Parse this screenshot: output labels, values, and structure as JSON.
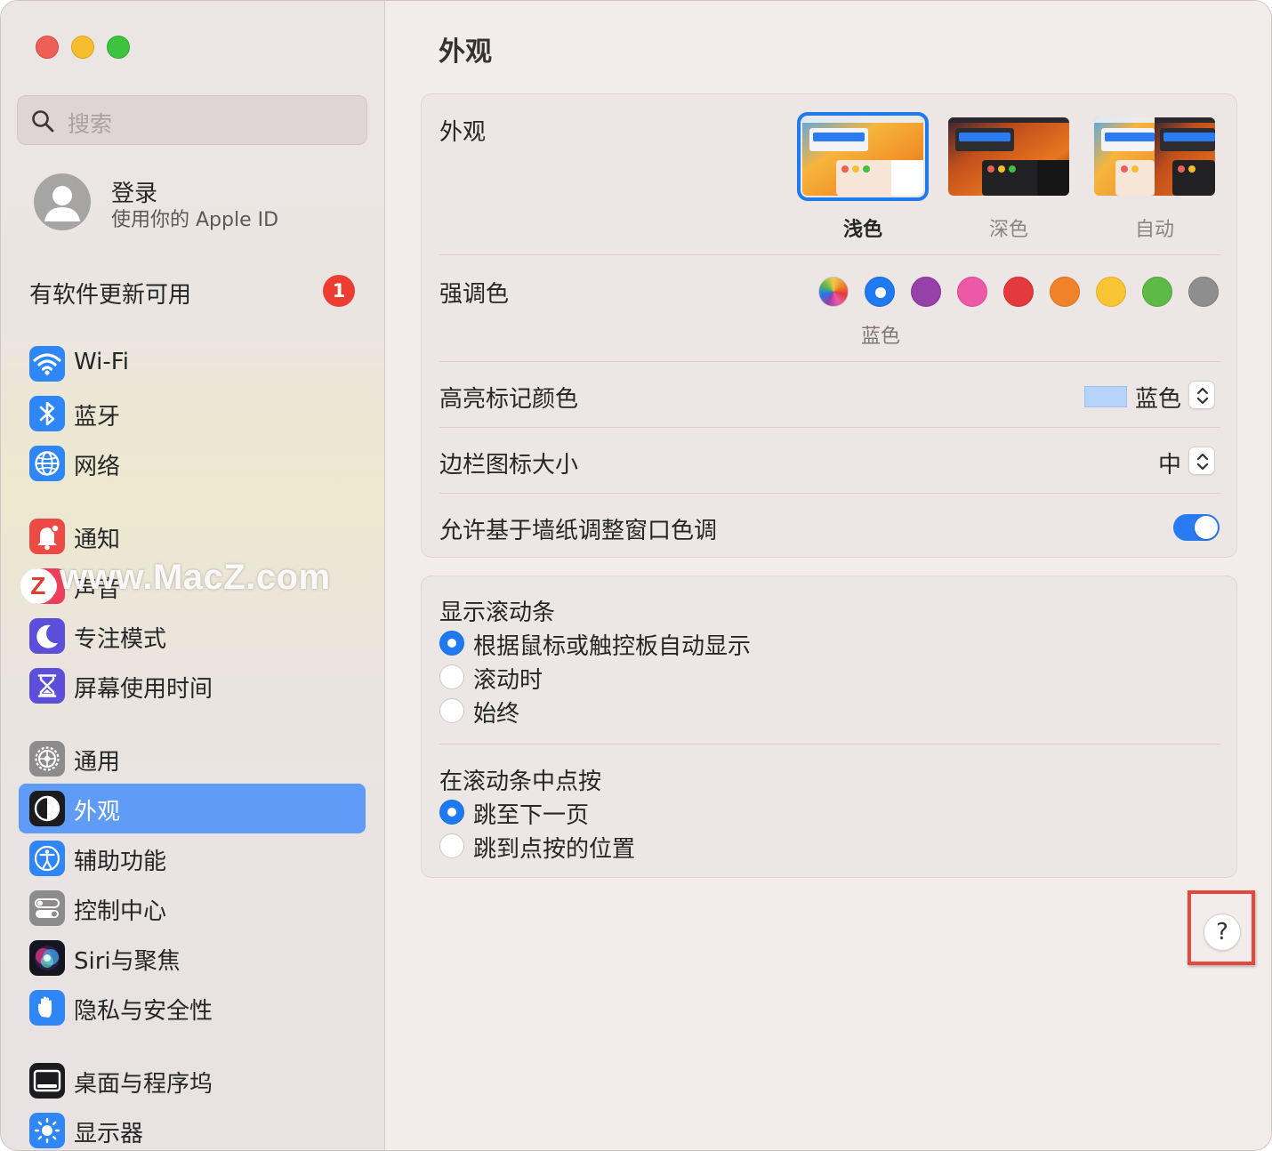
{
  "window": {
    "controls": [
      "close",
      "minimize",
      "zoom"
    ]
  },
  "sidebar": {
    "search": {
      "placeholder": "搜索"
    },
    "account": {
      "name": "登录",
      "subtitle": "使用你的 Apple ID"
    },
    "update": {
      "label": "有软件更新可用",
      "badge": "1"
    },
    "items": [
      {
        "label": "Wi-Fi",
        "icon": "wifi-icon"
      },
      {
        "label": "蓝牙",
        "icon": "bluetooth-icon"
      },
      {
        "label": "网络",
        "icon": "globe-icon"
      },
      {
        "label": "通知",
        "icon": "bell-icon"
      },
      {
        "label": "声音",
        "icon": "speaker-icon"
      },
      {
        "label": "专注模式",
        "icon": "moon-icon"
      },
      {
        "label": "屏幕使用时间",
        "icon": "hourglass-icon"
      },
      {
        "label": "通用",
        "icon": "gear-icon"
      },
      {
        "label": "外观",
        "icon": "appearance-icon",
        "active": true
      },
      {
        "label": "辅助功能",
        "icon": "accessibility-icon"
      },
      {
        "label": "控制中心",
        "icon": "toggles-icon"
      },
      {
        "label": "Siri与聚焦",
        "icon": "siri-icon"
      },
      {
        "label": "隐私与安全性",
        "icon": "hand-icon"
      },
      {
        "label": "桌面与程序坞",
        "icon": "dock-icon"
      },
      {
        "label": "显示器",
        "icon": "sun-icon"
      }
    ],
    "watermark": {
      "logo": "Z",
      "text": "www.MacZ.com"
    }
  },
  "main": {
    "title": "外观",
    "appearance": {
      "label": "外观",
      "options": [
        {
          "label": "浅色",
          "selected": true
        },
        {
          "label": "深色",
          "selected": false
        },
        {
          "label": "自动",
          "selected": false
        }
      ]
    },
    "accent": {
      "label": "强调色",
      "selected_name": "蓝色",
      "colors": [
        "#multicolor",
        "#1f7af0",
        "#9640a9",
        "#ec5aa5",
        "#e33a3f",
        "#f0822a",
        "#f8c436",
        "#5dba46",
        "#8e8e8e"
      ]
    },
    "highlight": {
      "label": "高亮标记颜色",
      "value": "蓝色",
      "swatch_color": "#b6d3fb"
    },
    "sidebar_icon_size": {
      "label": "边栏图标大小",
      "value": "中"
    },
    "wallpaper_tint": {
      "label": "允许基于墙纸调整窗口色调",
      "on": true
    },
    "scrollbars": {
      "label": "显示滚动条",
      "options": [
        {
          "label": "根据鼠标或触控板自动显示",
          "selected": true
        },
        {
          "label": "滚动时",
          "selected": false
        },
        {
          "label": "始终",
          "selected": false
        }
      ]
    },
    "click_scrollbar": {
      "label": "在滚动条中点按",
      "options": [
        {
          "label": "跳至下一页",
          "selected": true
        },
        {
          "label": "跳到点按的位置",
          "selected": false
        }
      ]
    },
    "help": {
      "label": "?"
    }
  },
  "colors": {
    "accent": "#1f7af0",
    "sidebar_selection": "#5f9cf8",
    "badge": "#eb3d32",
    "annotation_box": "#e5473f"
  }
}
